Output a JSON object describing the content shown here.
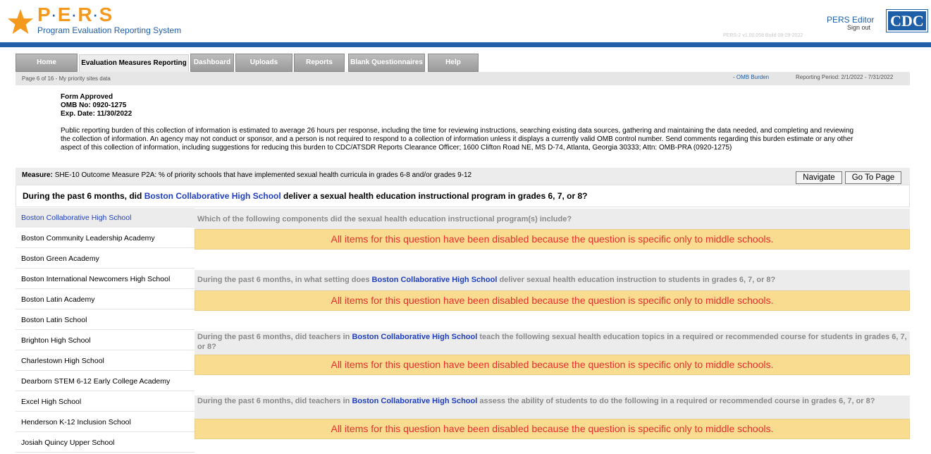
{
  "header": {
    "logo_letters": [
      "P",
      "E",
      "R",
      "S"
    ],
    "logo_subtitle": "Program Evaluation Reporting System",
    "editor_label": "PERS Editor",
    "signout_label": "Sign out",
    "cdc_label": "CDC",
    "version": "PERS-2 v1.00.058   Build 08-29-2022"
  },
  "colors": {
    "brand_blue": "#1f5fa8",
    "logo_orange": "#f39a1e",
    "disabled_bg": "#f9dc8f",
    "disabled_text": "#e62e2e"
  },
  "tabs": [
    {
      "label": "Home",
      "active": false
    },
    {
      "label": "Evaluation Measures Reporting",
      "active": true
    },
    {
      "label": "Dashboard",
      "active": false
    },
    {
      "label": "Uploads",
      "active": false
    },
    {
      "label": "Reports",
      "active": false
    },
    {
      "label": "Blank Questionnaires",
      "active": false
    },
    {
      "label": "Help",
      "active": false
    }
  ],
  "subbar": {
    "page_info": "Page 6 of 16 - My priority sites data",
    "omb_link": "- OMB Burden",
    "reporting_period": "Reporting Period: 2/1/2022 - 7/31/2022"
  },
  "form_approved": {
    "line1": "Form Approved",
    "line2": "OMB No: 0920-1275",
    "line3": "Exp. Date: 11/30/2022"
  },
  "burden_text": "Public reporting burden of this collection of information is estimated to average 26 hours per response, including the time for reviewing instructions, searching existing data sources, gathering and maintaining the data needed, and completing and reviewing the collection of information. An agency may not conduct or sponsor, and a person is not required to respond to a collection of information unless it displays a currently valid OMB control number. Send comments regarding this burden estimate or any other aspect of this collection of information, including suggestions for reducing this burden to CDC/ATSDR Reports Clearance Officer; 1600 Clifton Road NE, MS D-74, Atlanta, Georgia 30333; Attn: OMB-PRA (0920-1275)",
  "measure": {
    "label": "Measure:",
    "text": "SHE-10 Outcome Measure P2A: % of priority schools that have implemented sexual health curricula in grades 6-8 and/or grades 9-12",
    "navigate_button": "Navigate",
    "goto_button": "Go To Page"
  },
  "main_question": {
    "prefix": "During the past 6 months, did",
    "school": "Boston Collaborative High School",
    "suffix": "deliver a sexual health education instructional program in grades 6, 7, or 8?"
  },
  "schools": [
    {
      "name": "Boston Collaborative High School",
      "active": true
    },
    {
      "name": "Boston Community Leadership Academy",
      "active": false
    },
    {
      "name": "Boston Green Academy",
      "active": false
    },
    {
      "name": "Boston International Newcomers High School",
      "active": false
    },
    {
      "name": "Boston Latin Academy",
      "active": false
    },
    {
      "name": "Boston Latin School",
      "active": false
    },
    {
      "name": "Brighton High School",
      "active": false
    },
    {
      "name": "Charlestown High School",
      "active": false
    },
    {
      "name": "Dearborn STEM 6-12 Early College Academy",
      "active": false
    },
    {
      "name": "Excel High School",
      "active": false
    },
    {
      "name": "Henderson K-12 Inclusion School",
      "active": false
    },
    {
      "name": "Josiah Quincy Upper School",
      "active": false
    }
  ],
  "questions": [
    {
      "prefix": "Which of the following components did the sexual health education instructional program(s) include?",
      "school": "",
      "suffix": ""
    },
    {
      "prefix": "During the past 6 months, in what setting does",
      "school": "Boston Collaborative High School",
      "suffix": "deliver sexual health education instruction to students in grades 6, 7, or 8?"
    },
    {
      "prefix": "During the past 6 months, did teachers in",
      "school": "Boston Collaborative High School",
      "suffix": "teach the following sexual health education topics in a required or recommended course for students in grades 6, 7, or 8?"
    },
    {
      "prefix": "During the past 6 months, did teachers in",
      "school": "Boston Collaborative High School",
      "suffix": "assess the ability of students to do the following in a required or recommended course in grades 6, 7, or 8?"
    }
  ],
  "disabled_message": "All items for this question have been disabled because the question is specific only to middle schools."
}
